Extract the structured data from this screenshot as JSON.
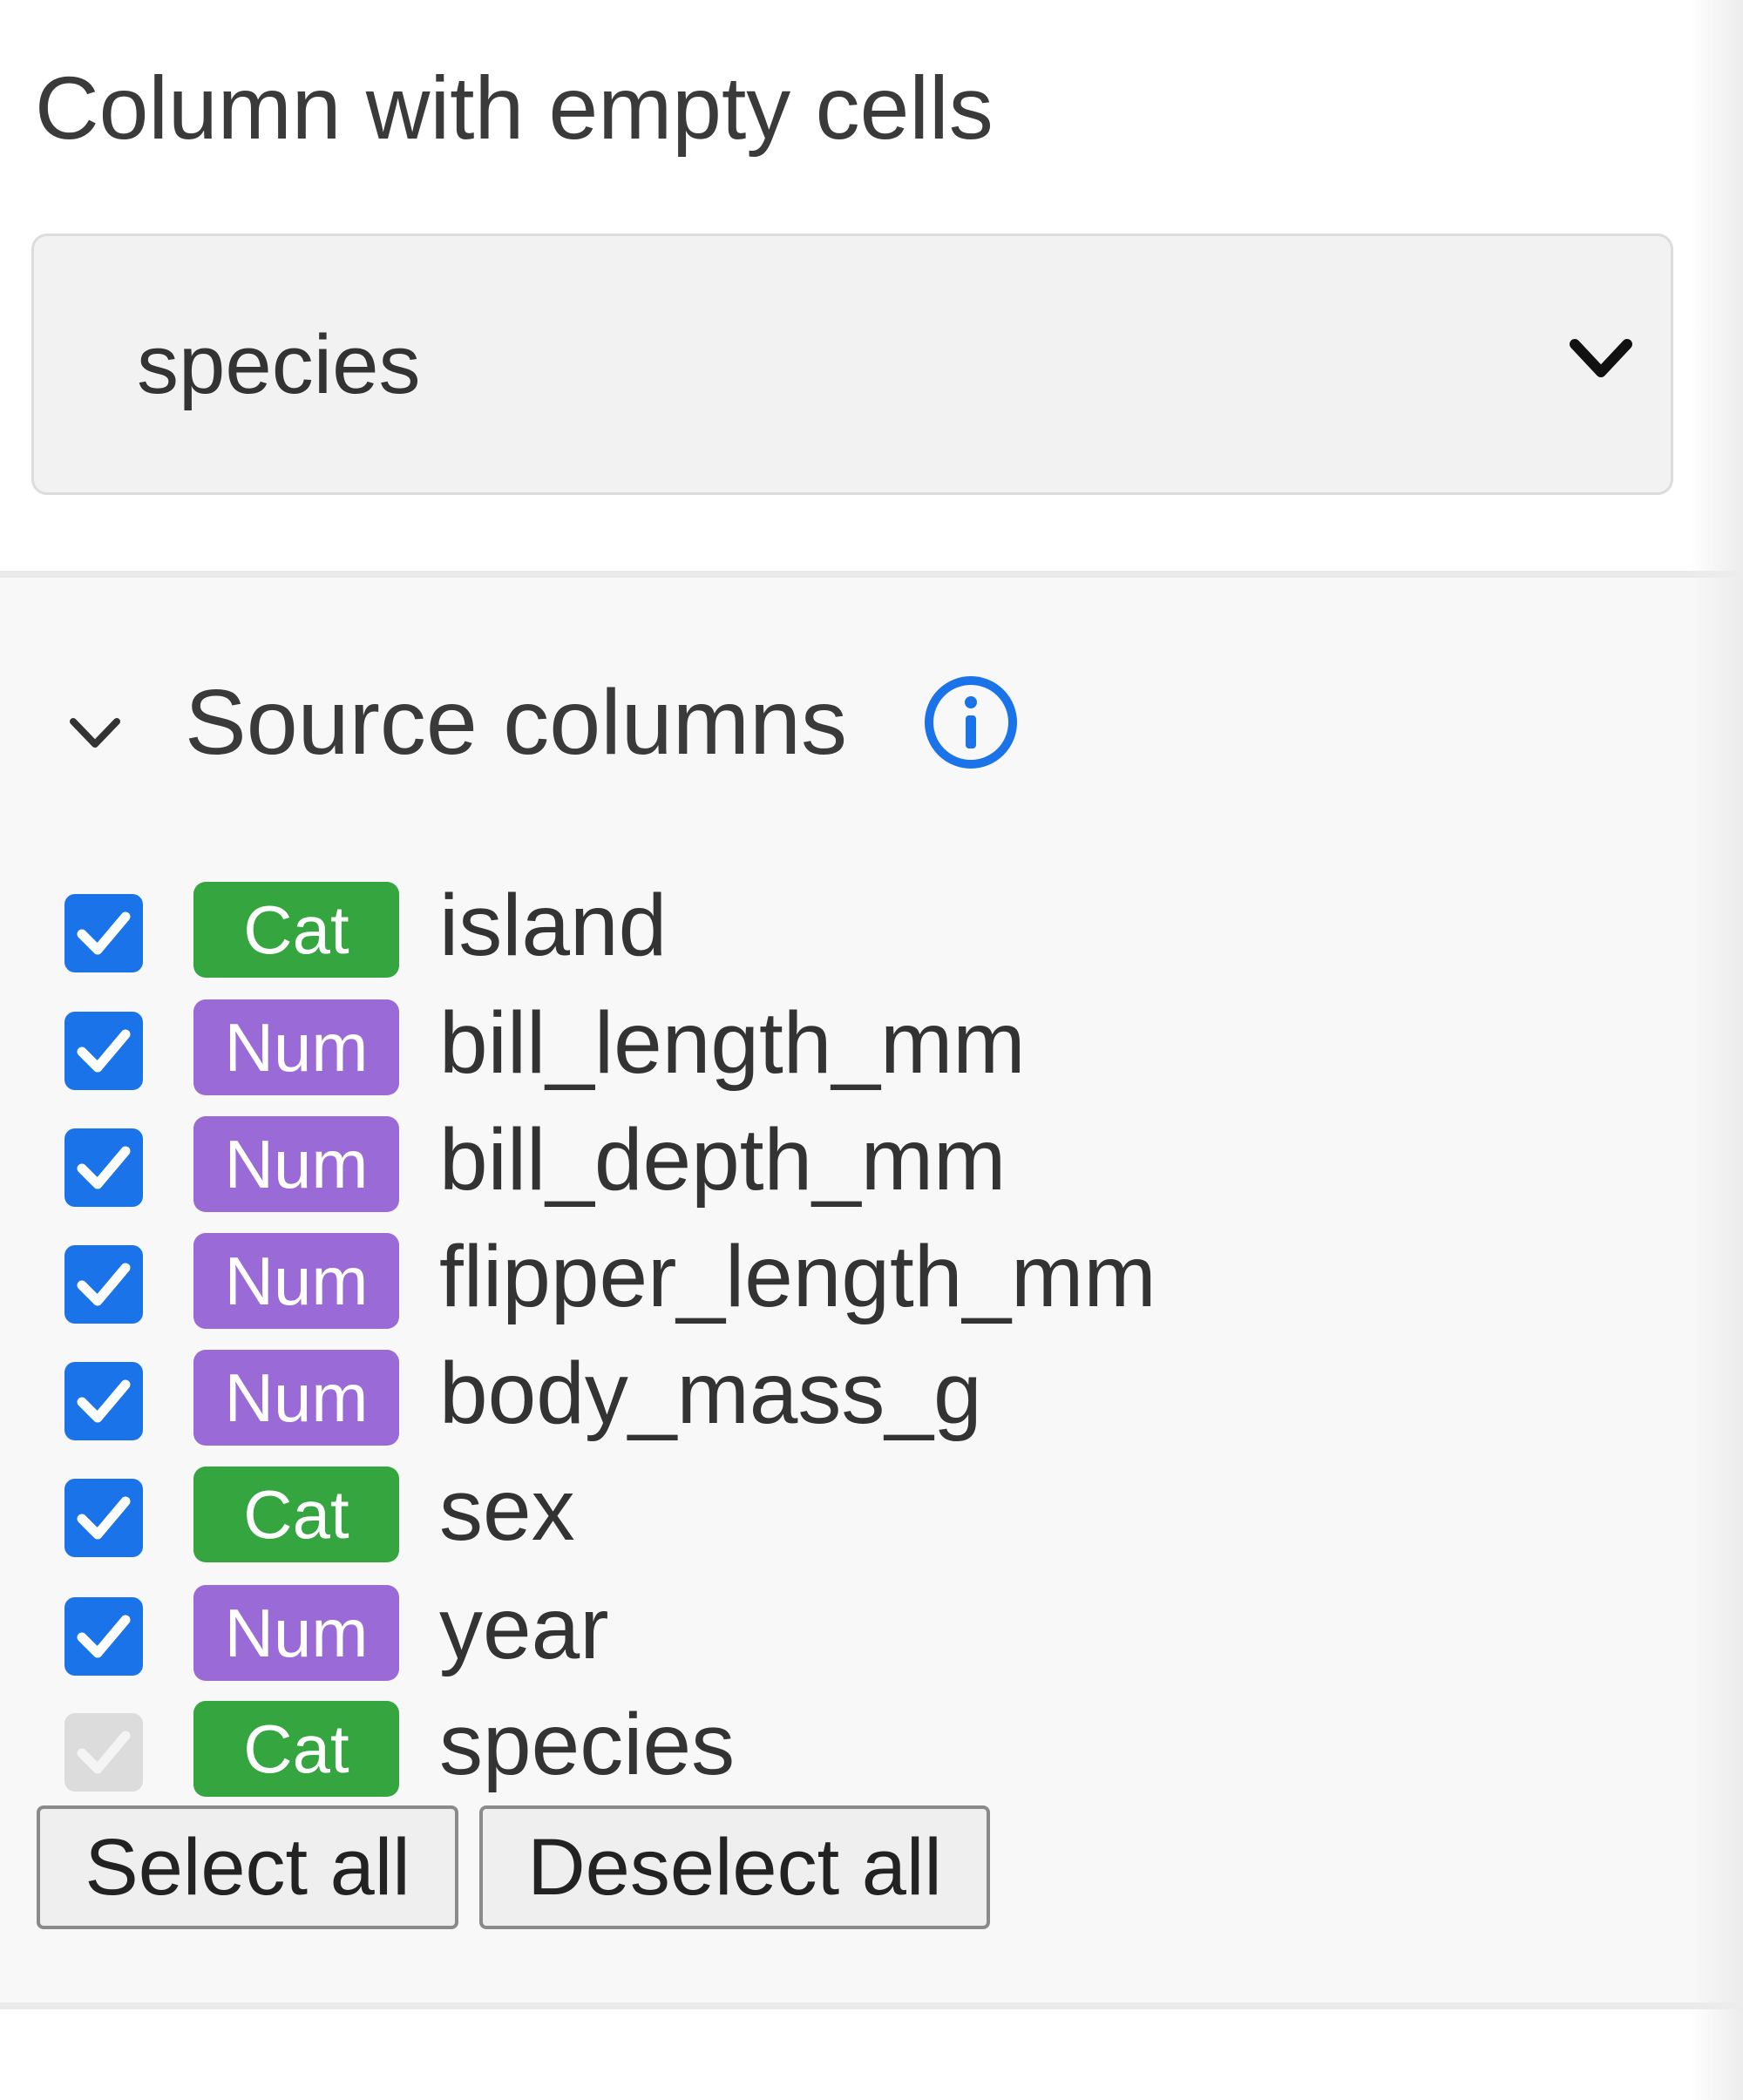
{
  "empty_column": {
    "title": "Column with empty cells",
    "selected": "species"
  },
  "source_columns": {
    "title": "Source columns",
    "columns": [
      {
        "type": "Cat",
        "name": "island",
        "checked": true,
        "disabled": false
      },
      {
        "type": "Num",
        "name": "bill_length_mm",
        "checked": true,
        "disabled": false
      },
      {
        "type": "Num",
        "name": "bill_depth_mm",
        "checked": true,
        "disabled": false
      },
      {
        "type": "Num",
        "name": "flipper_length_mm",
        "checked": true,
        "disabled": false
      },
      {
        "type": "Num",
        "name": "body_mass_g",
        "checked": true,
        "disabled": false
      },
      {
        "type": "Cat",
        "name": "sex",
        "checked": true,
        "disabled": false
      },
      {
        "type": "Num",
        "name": "year",
        "checked": true,
        "disabled": false
      },
      {
        "type": "Cat",
        "name": "species",
        "checked": true,
        "disabled": true
      }
    ],
    "select_all_label": "Select all",
    "deselect_all_label": "Deselect all"
  },
  "colors": {
    "cat_badge": "#34a53f",
    "num_badge": "#9a6ad6",
    "checkbox_checked": "#1a73e8",
    "checkbox_disabled": "#dcdcdc",
    "info_icon": "#1a73e8"
  },
  "icons": {
    "select_chevron": "chevron-down-icon",
    "collapse": "chevron-down-icon",
    "info": "info-icon",
    "check": "check-icon"
  }
}
